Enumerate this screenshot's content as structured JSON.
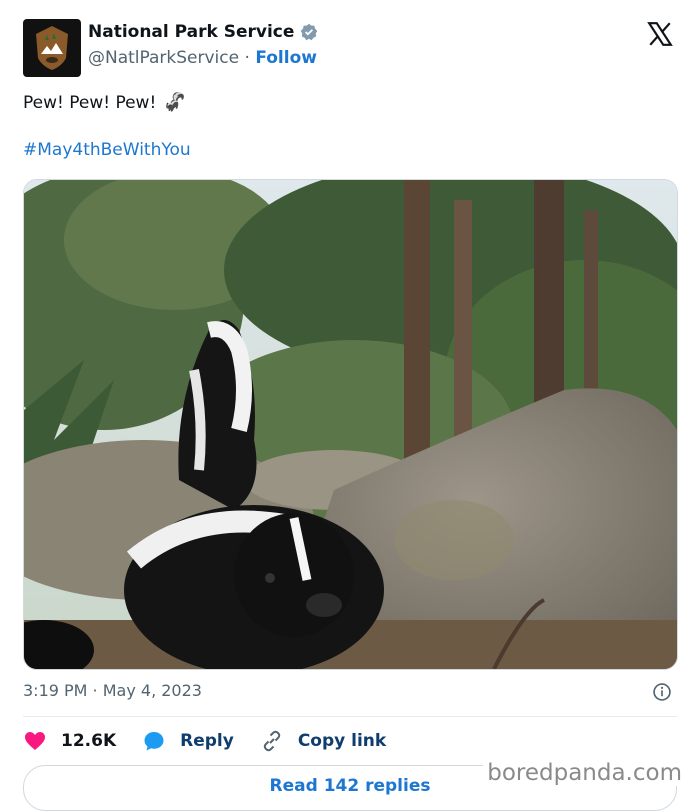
{
  "account": {
    "name": "National Park Service",
    "handle": "@NatlParkService",
    "separator": "·",
    "follow_label": "Follow"
  },
  "tweet": {
    "text": "Pew! Pew! Pew!",
    "emoji": "🦨",
    "hashtag": "#May4thBeWithYou",
    "timestamp": "3:19 PM · May 4, 2023"
  },
  "actions": {
    "likes": "12.6K",
    "reply_label": "Reply",
    "copy_label": "Copy link"
  },
  "read_replies_label": "Read 142 replies",
  "watermark": "boredpanda.com",
  "colors": {
    "link": "#1d77d1",
    "like": "#f91880",
    "muted": "#536471",
    "verified": "#829aab"
  },
  "icons": [
    "nps-logo-icon",
    "verified-badge-icon",
    "x-logo-icon",
    "info-icon",
    "heart-icon",
    "reply-bubble-icon",
    "link-icon"
  ]
}
